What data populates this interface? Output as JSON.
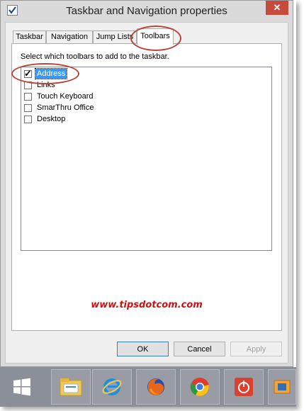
{
  "window": {
    "title": "Taskbar and Navigation properties",
    "close_glyph": "✕",
    "app_icon": "checkbox-app-icon"
  },
  "tabs": [
    {
      "label": "Taskbar",
      "active": false
    },
    {
      "label": "Navigation",
      "active": false
    },
    {
      "label": "Jump Lists",
      "active": false
    },
    {
      "label": "Toolbars",
      "active": true
    }
  ],
  "toolbars_panel": {
    "instruction": "Select which toolbars to add to the taskbar.",
    "items": [
      {
        "label": "Address",
        "checked": true,
        "selected": true
      },
      {
        "label": "Links",
        "checked": false,
        "selected": false
      },
      {
        "label": "Touch Keyboard",
        "checked": false,
        "selected": false
      },
      {
        "label": "SmarThru Office",
        "checked": false,
        "selected": false
      },
      {
        "label": "Desktop",
        "checked": false,
        "selected": false
      }
    ]
  },
  "watermark": "www.tipsdotcom.com",
  "buttons": {
    "ok": "OK",
    "cancel": "Cancel",
    "apply": "Apply"
  },
  "taskbar": {
    "items": [
      "start-windows-icon",
      "file-explorer-icon",
      "internet-explorer-icon",
      "firefox-icon",
      "chrome-icon",
      "power-app-icon",
      "overflow-app-icon"
    ]
  },
  "colors": {
    "annotation_red": "#b8443b",
    "watermark_red": "#cc1111",
    "selection_blue": "#3399ff",
    "close_red": "#c74a3f"
  }
}
